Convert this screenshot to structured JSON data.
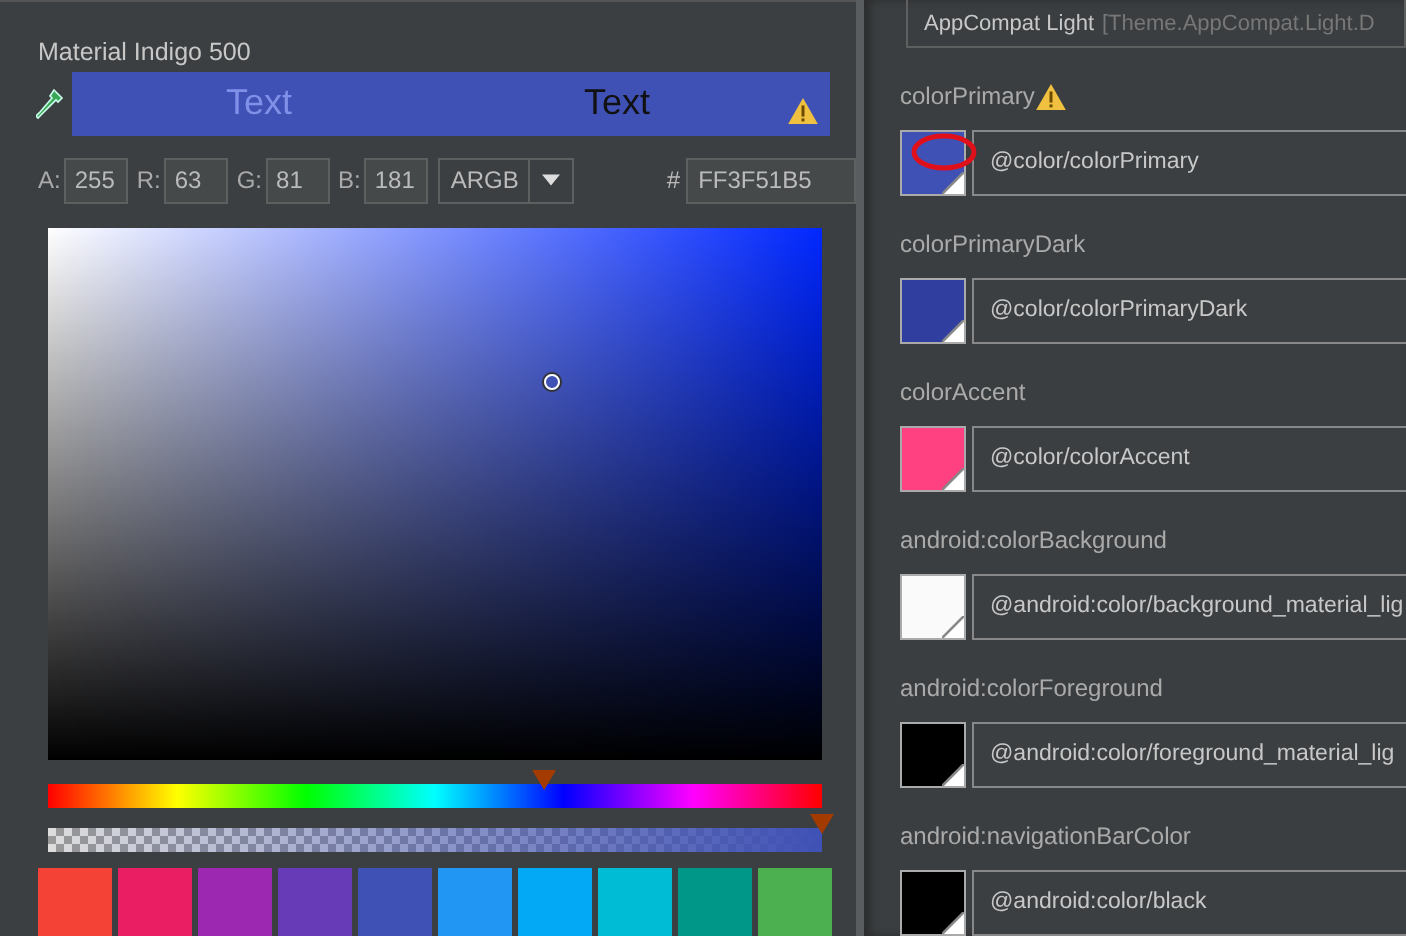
{
  "color_picker": {
    "title": "Material Indigo 500",
    "preview": {
      "color": "#3f51b5",
      "sample_texts": [
        "Text",
        "Text"
      ]
    },
    "channels": [
      {
        "label": "A:",
        "value": "255"
      },
      {
        "label": "R:",
        "value": "63"
      },
      {
        "label": "G:",
        "value": "81"
      },
      {
        "label": "B:",
        "value": "181"
      }
    ],
    "mode": "ARGB",
    "hex_label": "#",
    "hex": "FF3F51B5",
    "hue_slider": {
      "level": 0.641
    },
    "alpha_slider": {
      "level": 1
    },
    "swatches": [
      {
        "color": "#f44336"
      },
      {
        "color": "#e91e63"
      },
      {
        "color": "#9c27b0"
      },
      {
        "color": "#673ab7"
      },
      {
        "color": "#3f51b5"
      },
      {
        "color": "#2196f3"
      },
      {
        "color": "#03a9f4"
      },
      {
        "color": "#00bcd4"
      },
      {
        "color": "#009688"
      },
      {
        "color": "#4caf50"
      }
    ]
  },
  "theme_editor": {
    "theme": {
      "name": "AppCompat Light",
      "parent": "[Theme.AppCompat.Light.D"
    },
    "attributes": [
      {
        "name": "colorPrimary",
        "warning": true,
        "annotated": true,
        "color": "#3f51b5",
        "value": "@color/colorPrimary"
      },
      {
        "name": "colorPrimaryDark",
        "warning": false,
        "annotated": false,
        "color": "#303f9f",
        "value": "@color/colorPrimaryDark"
      },
      {
        "name": "colorAccent",
        "warning": false,
        "annotated": false,
        "color": "#ff4081",
        "value": "@color/colorAccent"
      },
      {
        "name": "android:colorBackground",
        "warning": false,
        "annotated": false,
        "color": "#fafafa",
        "value": "@android:color/background_material_lig"
      },
      {
        "name": "android:colorForeground",
        "warning": false,
        "annotated": false,
        "color": "#000000",
        "value": "@android:color/foreground_material_lig"
      },
      {
        "name": "android:navigationBarColor",
        "warning": false,
        "annotated": false,
        "color": "#000000",
        "value": "@android:color/black"
      }
    ]
  }
}
